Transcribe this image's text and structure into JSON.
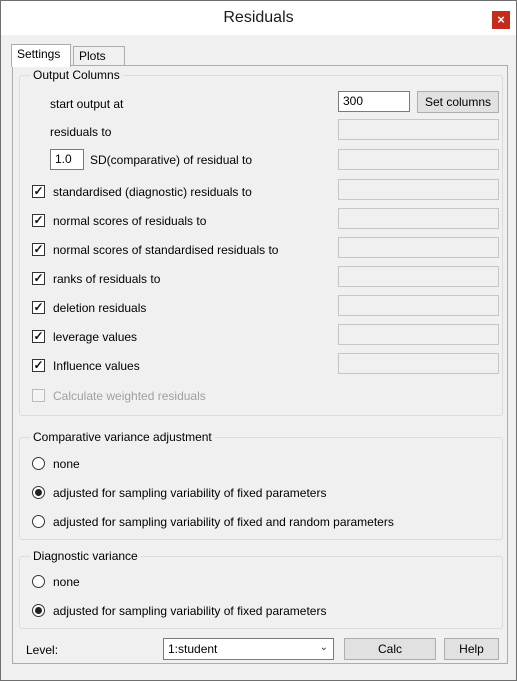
{
  "window": {
    "title": "Residuals",
    "close_glyph": "×"
  },
  "tabs": [
    {
      "label": "Settings",
      "selected": true
    },
    {
      "label": "Plots",
      "selected": false
    }
  ],
  "output_columns": {
    "title": "Output Columns",
    "start_output_label": "start output at",
    "start_output_value": "300",
    "set_columns_label": "Set columns",
    "residuals_to_label": "residuals to",
    "residuals_to_value": "",
    "sd_value": "1.0",
    "sd_label": "SD(comparative) of residual to",
    "sd_target_value": "",
    "options": [
      {
        "label": "standardised (diagnostic) residuals to",
        "checked": true,
        "target": ""
      },
      {
        "label": "normal scores of residuals to",
        "checked": true,
        "target": ""
      },
      {
        "label": "normal scores of standardised residuals to",
        "checked": true,
        "target": ""
      },
      {
        "label": "ranks of residuals to",
        "checked": true,
        "target": ""
      },
      {
        "label": "deletion residuals",
        "checked": true,
        "target": ""
      },
      {
        "label": "leverage values",
        "checked": true,
        "target": ""
      },
      {
        "label": "Influence values",
        "checked": true,
        "target": ""
      }
    ],
    "weighted": {
      "label": "Calculate weighted residuals",
      "checked": false,
      "enabled": false
    }
  },
  "comparative_variance": {
    "title": "Comparative variance adjustment",
    "options": [
      {
        "label": "none",
        "selected": false
      },
      {
        "label": "adjusted for sampling variability of fixed parameters",
        "selected": true
      },
      {
        "label": "adjusted for sampling variability of fixed and random parameters",
        "selected": false
      }
    ]
  },
  "diagnostic_variance": {
    "title": "Diagnostic variance",
    "options": [
      {
        "label": "none",
        "selected": false
      },
      {
        "label": "adjusted for sampling variability of fixed parameters",
        "selected": true
      }
    ]
  },
  "footer": {
    "level_label": "Level:",
    "level_value": "1:student",
    "calc_label": "Calc",
    "help_label": "Help"
  },
  "glyphs": {
    "check": "✓",
    "dropdown": "⌄"
  }
}
